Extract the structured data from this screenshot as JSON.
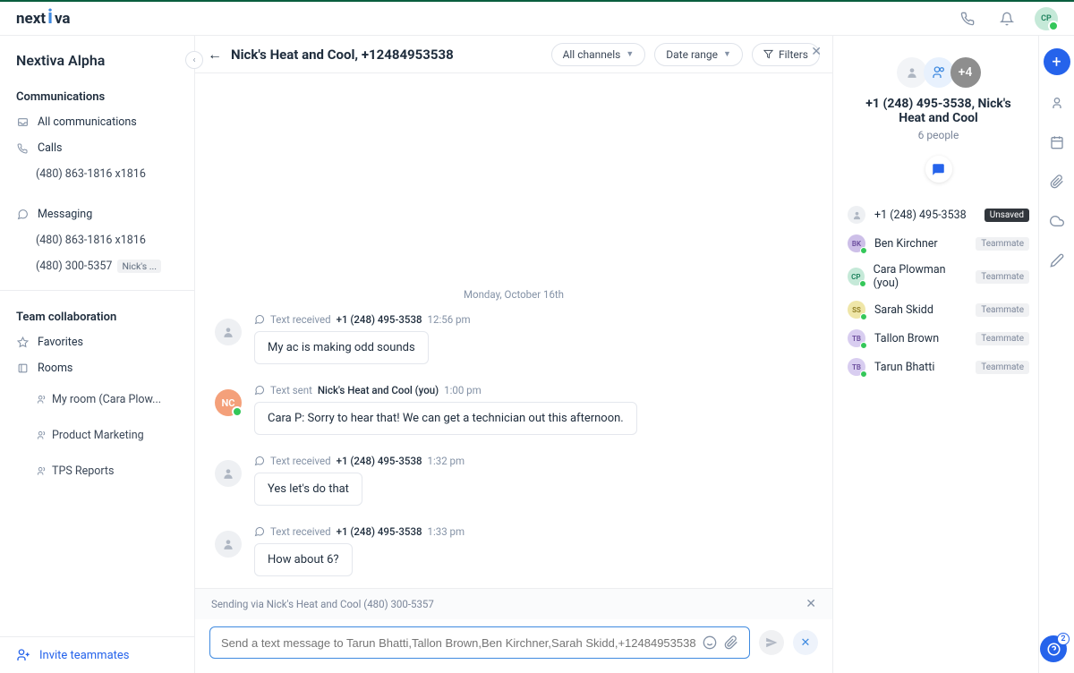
{
  "brand": "nextiva",
  "topbar": {
    "avatar_initials": "CP"
  },
  "workspace": "Nextiva Alpha",
  "sidebar": {
    "section_communications": "Communications",
    "all_comms": "All communications",
    "calls": "Calls",
    "calls_number": "(480) 863-1816 x1816",
    "messaging": "Messaging",
    "msg_number1": "(480) 863-1816 x1816",
    "msg_number2": "(480) 300-5357",
    "msg_number2_chip": "Nick's ...",
    "section_team": "Team collaboration",
    "favorites": "Favorites",
    "rooms": "Rooms",
    "room1": "My room (Cara Plow...",
    "room2": "Product Marketing",
    "room3": "TPS Reports",
    "invite": "Invite teammates"
  },
  "conversation": {
    "title": "Nick's Heat and Cool, +12484953538",
    "all_channels": "All channels",
    "date_range": "Date range",
    "filters": "Filters",
    "date_sep": "Monday, October 16th",
    "messages": [
      {
        "action": "Text received",
        "who": "+1 (248) 495-3538",
        "time": "12:56 pm",
        "body": "My ac is making odd sounds",
        "avatar": "person"
      },
      {
        "action": "Text sent",
        "who": "Nick's Heat and Cool (you)",
        "time": "1:00 pm",
        "body": "Cara P: Sorry to hear that! We can get a technician out this afternoon.",
        "avatar": "NC"
      },
      {
        "action": "Text received",
        "who": "+1 (248) 495-3538",
        "time": "1:32 pm",
        "body": "Yes let's do that",
        "avatar": "person"
      },
      {
        "action": "Text received",
        "who": "+1 (248) 495-3538",
        "time": "1:33 pm",
        "body": "How about 6?",
        "avatar": "person"
      }
    ],
    "compose_hint": "Sending via Nick's Heat and Cool (480) 300-5357",
    "compose_placeholder": "Send a text message to Tarun Bhatti,Tallon Brown,Ben Kirchner,Sarah Skidd,+12484953538..."
  },
  "detail": {
    "plus_count": "+4",
    "title": "+1 (248) 495-3538, Nick's Heat and Cool",
    "subtitle": "6 people",
    "members": [
      {
        "name": "+1 (248) 495-3538",
        "badge": "Unsaved",
        "badge_style": "dark",
        "cls": "grey",
        "initials": "👤"
      },
      {
        "name": "Ben Kirchner",
        "badge": "Teammate",
        "badge_style": "light",
        "cls": "bk",
        "initials": "BK"
      },
      {
        "name": "Cara Plowman (you)",
        "badge": "Teammate",
        "badge_style": "light",
        "cls": "cp",
        "initials": "CP"
      },
      {
        "name": "Sarah Skidd",
        "badge": "Teammate",
        "badge_style": "light",
        "cls": "ss",
        "initials": "SS"
      },
      {
        "name": "Tallon Brown",
        "badge": "Teammate",
        "badge_style": "light",
        "cls": "tb",
        "initials": "TB"
      },
      {
        "name": "Tarun Bhatti",
        "badge": "Teammate",
        "badge_style": "light",
        "cls": "tb2",
        "initials": "TB"
      }
    ]
  },
  "help_badge": "2"
}
